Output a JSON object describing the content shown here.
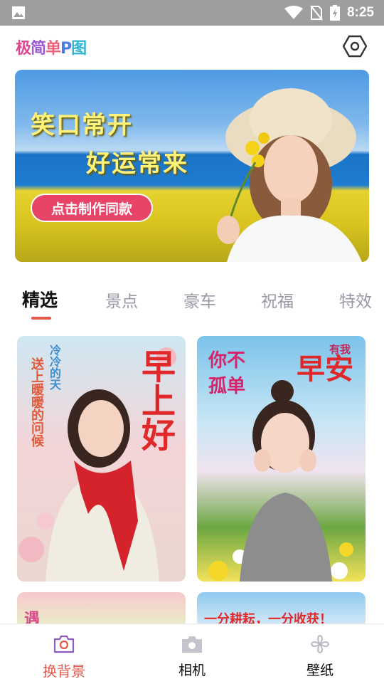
{
  "status_bar": {
    "time": "8:25",
    "icons": [
      "image-icon",
      "wifi-icon",
      "no-sim-icon",
      "battery-charging-icon"
    ]
  },
  "app": {
    "logo": [
      "极",
      "简",
      "单",
      "P",
      "图"
    ],
    "settings_icon": "hexagon-settings-icon"
  },
  "banner": {
    "line1": "笑口常开",
    "line2": "好运常来",
    "cta_label": "点击制作同款"
  },
  "tabs": [
    {
      "label": "精选",
      "active": true
    },
    {
      "label": "景点",
      "active": false
    },
    {
      "label": "豪车",
      "active": false
    },
    {
      "label": "祝福",
      "active": false
    },
    {
      "label": "特效",
      "active": false
    }
  ],
  "cards": [
    {
      "title": "早上好",
      "verse": "冷冷的天",
      "verse2": "送上暖暖的问候"
    },
    {
      "title": "早安",
      "badge": "有我",
      "verse": "你不",
      "verse2": "孤单"
    },
    {
      "title": "遇"
    },
    {
      "title": "一分耕耘，一分收获！"
    }
  ],
  "bottom_nav": [
    {
      "label": "换背景",
      "icon": "camera-outline-icon",
      "active": true
    },
    {
      "label": "相机",
      "icon": "camera-icon",
      "active": false
    },
    {
      "label": "壁纸",
      "icon": "pinwheel-icon",
      "active": false
    }
  ],
  "colors": {
    "accent": "#e4574a",
    "cta": "#e84468",
    "status_bar": "#9e9e9e"
  }
}
